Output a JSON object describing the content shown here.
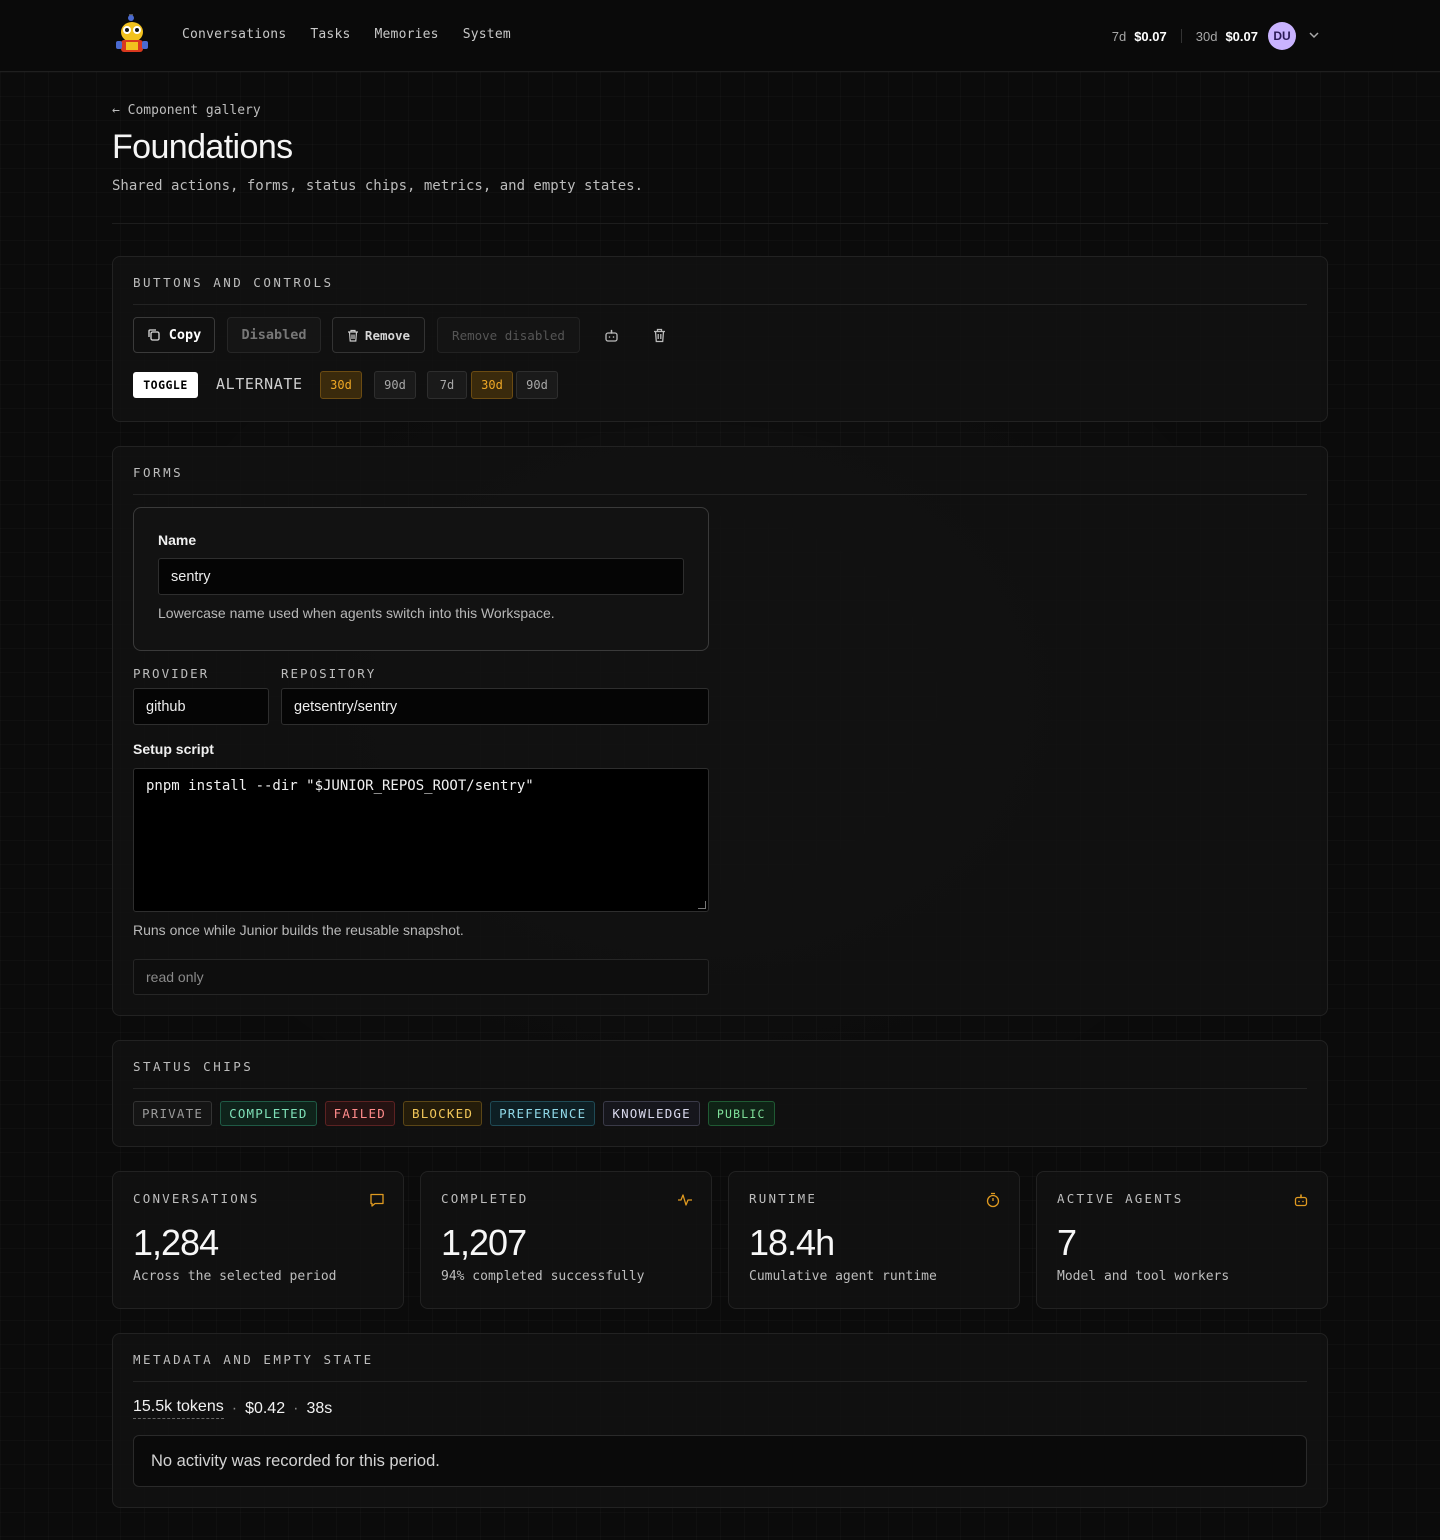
{
  "nav": {
    "items": [
      "Conversations",
      "Tasks",
      "Memories",
      "System"
    ]
  },
  "usage": {
    "label_7d": "7d",
    "value_7d": "$0.07",
    "label_30d": "30d",
    "value_30d": "$0.07",
    "avatar": "DU"
  },
  "page": {
    "back": "← Component gallery",
    "title": "Foundations",
    "subtitle": "Shared actions, forms, status chips, metrics, and empty states."
  },
  "buttons": {
    "section_title": "BUTTONS AND CONTROLS",
    "copy": "Copy",
    "disabled": "Disabled",
    "remove": "Remove",
    "remove_disabled": "Remove disabled",
    "toggle": "TOGGLE",
    "alternate": "ALTERNATE",
    "seg1": "30d",
    "seg2": "90d",
    "seg3": "7d",
    "seg4": "30d",
    "seg5": "90d"
  },
  "forms": {
    "section_title": "FORMS",
    "name_label": "Name",
    "name_value": "sentry",
    "name_help": "Lowercase name used when agents switch into this Workspace.",
    "provider_label": "PROVIDER",
    "provider_value": "github",
    "repo_label": "REPOSITORY",
    "repo_value": "getsentry/sentry",
    "setup_label": "Setup script",
    "setup_value": "pnpm install --dir \"$JUNIOR_REPOS_ROOT/sentry\"",
    "setup_help": "Runs once while Junior builds the reusable snapshot.",
    "readonly_value": "read only"
  },
  "chips": {
    "section_title": "STATUS CHIPS",
    "items": [
      "PRIVATE",
      "COMPLETED",
      "FAILED",
      "BLOCKED",
      "PREFERENCE",
      "KNOWLEDGE",
      "PUBLIC"
    ]
  },
  "metrics": [
    {
      "label": "CONVERSATIONS",
      "value": "1,284",
      "sub": "Across the selected period",
      "icon": "message-icon"
    },
    {
      "label": "COMPLETED",
      "value": "1,207",
      "sub": "94% completed successfully",
      "icon": "activity-icon"
    },
    {
      "label": "RUNTIME",
      "value": "18.4h",
      "sub": "Cumulative agent runtime",
      "icon": "timer-icon"
    },
    {
      "label": "ACTIVE AGENTS",
      "value": "7",
      "sub": "Model and tool workers",
      "icon": "bot-icon"
    }
  ],
  "meta": {
    "section_title": "METADATA AND EMPTY STATE",
    "tokens": "15.5k tokens",
    "cost": "$0.42",
    "duration": "38s",
    "empty": "No activity was recorded for this period."
  },
  "colors": {
    "accent": "#f0a825",
    "avatar": "#c9b3ff"
  }
}
